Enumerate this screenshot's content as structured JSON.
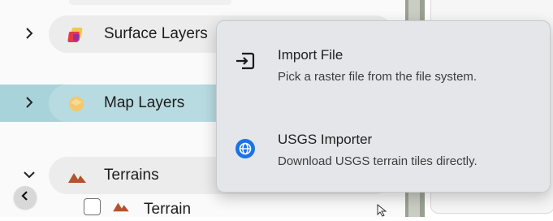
{
  "tree": {
    "rows": [
      {
        "label": "Surface Layers",
        "expanded": false,
        "selected": false,
        "icon": "surface-layers-icon"
      },
      {
        "label": "Map Layers",
        "expanded": false,
        "selected": true,
        "icon": "map-layers-icon"
      },
      {
        "label": "Terrains",
        "expanded": true,
        "selected": false,
        "icon": "mountain-icon"
      }
    ],
    "sub_item": {
      "label": "Terrain",
      "checked": false,
      "icon": "mountain-icon"
    }
  },
  "context_menu": {
    "items": [
      {
        "title": "Import File",
        "description": "Pick a raster file from the file system.",
        "icon": "import-file-icon"
      },
      {
        "title": "USGS Importer",
        "description": "Download USGS terrain tiles directly.",
        "icon": "globe-icon"
      }
    ]
  },
  "colors": {
    "selected_row": "#a9d3da",
    "popup_bg": "#e4e6e9",
    "accent_blue": "#1a73e8",
    "mountain": "#b5522e"
  }
}
